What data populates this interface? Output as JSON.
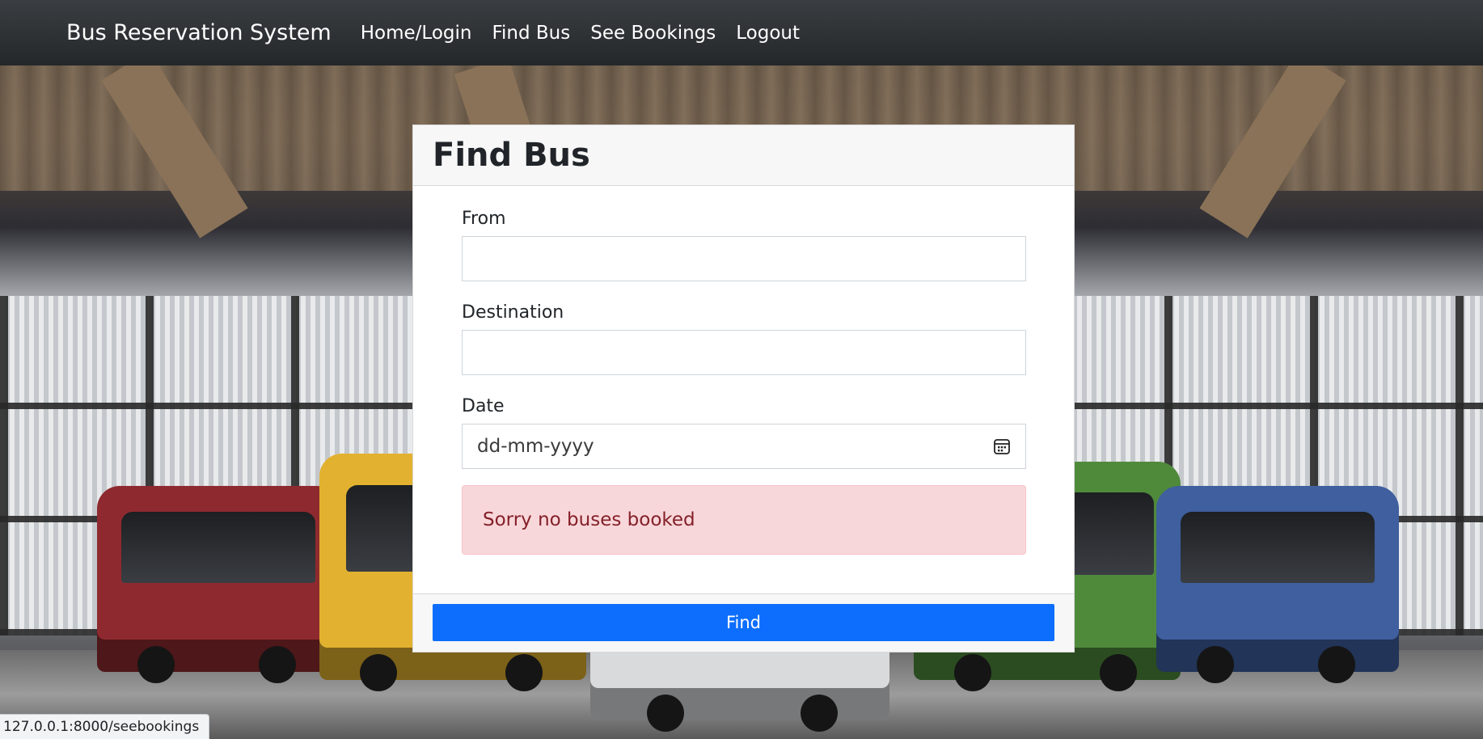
{
  "navbar": {
    "brand": "Bus Reservation System",
    "links": [
      "Home/Login",
      "Find Bus",
      "See Bookings",
      "Logout"
    ]
  },
  "card": {
    "title": "Find Bus",
    "from_label": "From",
    "from_value": "",
    "destination_label": "Destination",
    "destination_value": "",
    "date_label": "Date",
    "date_placeholder": "dd-mm-yyyy",
    "alert_text": "Sorry no buses booked",
    "submit_label": "Find"
  },
  "status_bar": {
    "url": "127.0.0.1:8000/seebookings"
  },
  "colors": {
    "navbar": "#2b2f33",
    "primary": "#0d6efd",
    "alert_bg": "#f8d7da",
    "alert_text": "#842029"
  },
  "icons": {
    "date_picker": "calendar-icon"
  }
}
